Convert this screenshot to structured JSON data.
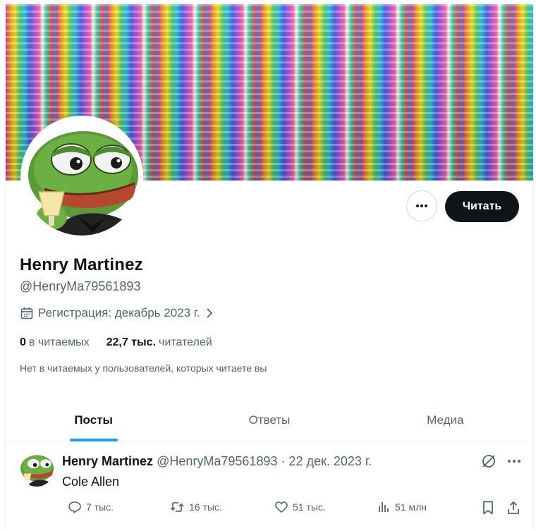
{
  "profile": {
    "name": "Henry Martinez",
    "handle": "@HenryMa79561893",
    "joined": "Регистрация: декабрь 2023 г.",
    "following_count": "0",
    "following_label": "в читаемых",
    "followers_count": "22,7 тыс.",
    "followers_label": "читателей",
    "mutuals_note": "Нет в читаемых у пользователей, которых читаете вы",
    "follow_label": "Читать"
  },
  "tabs": [
    {
      "label": "Посты",
      "active": true
    },
    {
      "label": "Ответы",
      "active": false
    },
    {
      "label": "Медиа",
      "active": false
    }
  ],
  "post": {
    "author_name": "Henry Martinez",
    "author_meta": "@HenryMa79561893 · 22 дек. 2023 г.",
    "text": "Cole Allen",
    "replies": "7 тыс.",
    "reposts": "16 тыс.",
    "likes": "51 тыс.",
    "views": "51 млн"
  },
  "icons": {
    "more": "more-horizontal-icon",
    "calendar": "calendar-icon",
    "chevron": "chevron-right-icon",
    "grok": "grok-icon",
    "reply": "reply-icon",
    "repost": "repost-icon",
    "like": "heart-icon",
    "views": "views-chart-icon",
    "bookmark": "bookmark-icon",
    "share": "share-icon"
  },
  "colors": {
    "accent": "#1d9bf0",
    "text": "#0f1419",
    "secondary": "#536471",
    "follow_bg": "#0f1419",
    "border": "#eff3f4"
  }
}
